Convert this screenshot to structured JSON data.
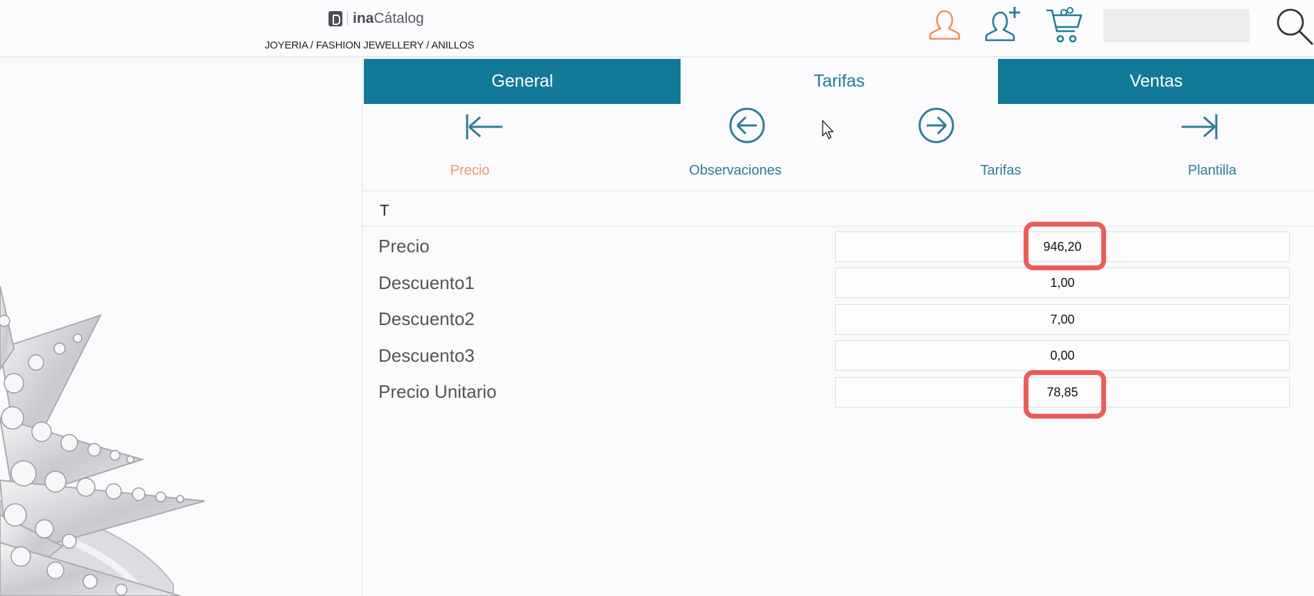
{
  "header": {
    "logo": {
      "brand_bold": "ina",
      "brand_rest": "Cátalog"
    },
    "breadcrumb": "JOYERIA / FASHION JEWELLERY / ANILLOS",
    "icons": [
      "user-icon",
      "add-user-icon",
      "cart-icon",
      "search-icon"
    ],
    "search_value": ""
  },
  "tabs": [
    {
      "label": "General",
      "active": false
    },
    {
      "label": "Tarifas",
      "active": true
    },
    {
      "label": "Ventas",
      "active": false
    }
  ],
  "nav": {
    "icons": [
      "first-icon",
      "previous-icon",
      "next-icon",
      "last-icon"
    ],
    "labels": [
      {
        "label": "Precio",
        "current": true
      },
      {
        "label": "Observaciones",
        "current": false
      },
      {
        "label": "Tarifas",
        "current": false
      },
      {
        "label": "Plantilla",
        "current": false
      }
    ]
  },
  "section": {
    "title": "T"
  },
  "fields": [
    {
      "label": "Precio",
      "value": "946,20",
      "highlighted": true
    },
    {
      "label": "Descuento1",
      "value": "1,00",
      "highlighted": false
    },
    {
      "label": "Descuento2",
      "value": "7,00",
      "highlighted": false
    },
    {
      "label": "Descuento3",
      "value": "0,00",
      "highlighted": false
    },
    {
      "label": "Precio Unitario",
      "value": "78,85",
      "highlighted": true
    }
  ],
  "colors": {
    "tab_active_bg": "#127a98",
    "accent": "#1d7d99",
    "current_link": "#e69a6a",
    "user_icon": "#e7955f",
    "highlight": "#ec5d57"
  }
}
